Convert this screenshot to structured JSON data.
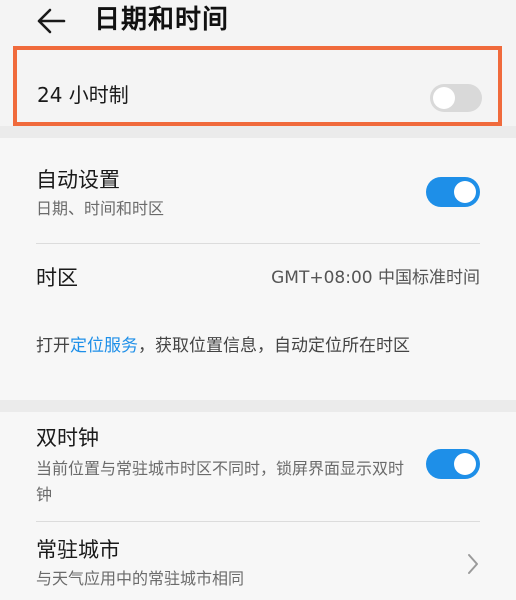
{
  "header": {
    "title": "日期和时间",
    "back_icon": "arrow-left-icon"
  },
  "rows": {
    "hour24": {
      "label": "24 小时制",
      "toggle_on": false
    },
    "auto_set": {
      "title": "自动设置",
      "subtitle": "日期、时间和时区",
      "toggle_on": true
    },
    "timezone": {
      "title": "时区",
      "value": "GMT+08:00 中国标准时间"
    },
    "location_note": {
      "prefix": "打开",
      "link": "定位服务",
      "suffix": "，获取位置信息，自动定位所在时区"
    },
    "dual_clock": {
      "title": "双时钟",
      "subtitle": "当前位置与常驻城市时区不同时，锁屏界面显示双时钟",
      "toggle_on": true
    },
    "home_city": {
      "title": "常驻城市",
      "subtitle": "与天气应用中的常驻城市相同",
      "chevron_icon": "chevron-right-icon"
    }
  },
  "colors": {
    "accent": "#1e8fe8",
    "highlight_border": "#f06a3c",
    "toggle_off": "#d9d9d9"
  }
}
